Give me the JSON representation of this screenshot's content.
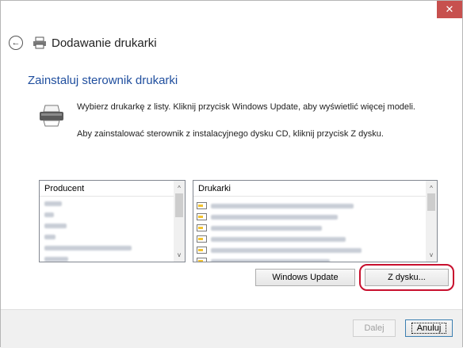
{
  "window": {
    "close_glyph": "✕"
  },
  "nav": {
    "back_glyph": "←",
    "title": "Dodawanie drukarki"
  },
  "main": {
    "heading": "Zainstaluj sterownik drukarki",
    "line1": "Wybierz drukarkę z listy. Kliknij przycisk Windows Update, aby wyświetlić więcej modeli.",
    "line2": "Aby zainstalować sterownik z instalacyjnego dysku CD, kliknij przycisk Z dysku."
  },
  "manufacturers": {
    "header": "Producent",
    "scroll_up": "^",
    "scroll_down": "v"
  },
  "printers": {
    "header": "Drukarki",
    "scroll_up": "^",
    "scroll_down": "v"
  },
  "buttons": {
    "windows_update": "Windows Update",
    "from_disk": "Z dysku...",
    "next": "Dalej",
    "cancel": "Anuluj"
  },
  "colors": {
    "heading": "#1f4e9e",
    "highlight": "#c8102e",
    "close": "#c7504e"
  },
  "icons": [
    "close-icon",
    "back-arrow-icon",
    "printer-icon",
    "printer-large-icon",
    "driver-icon"
  ]
}
